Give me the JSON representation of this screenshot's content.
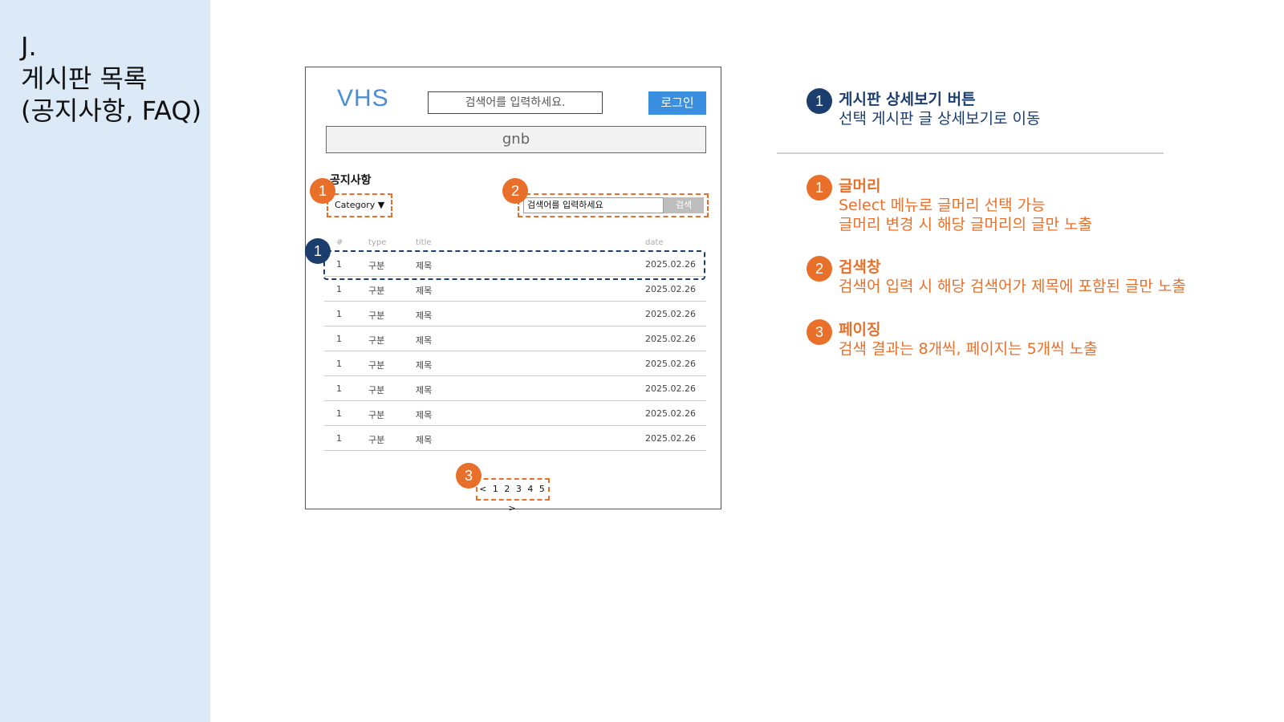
{
  "slide": {
    "title_lines": [
      "J.",
      "게시판 목록",
      "(공지사항, FAQ)"
    ]
  },
  "mockup": {
    "logo": "VHS",
    "top_search_placeholder": "검색어를 입력하세요.",
    "login_label": "로그인",
    "gnb_label": "gnb",
    "board_title": "공지사항",
    "category_label": "Category ▼",
    "search_placeholder": "검색어를 입력하세요",
    "search_button": "검색",
    "columns": [
      "#",
      "type",
      "title",
      "date"
    ],
    "rows": [
      {
        "no": "1",
        "type": "구분",
        "title": "제목",
        "date": "2025.02.26"
      },
      {
        "no": "1",
        "type": "구분",
        "title": "제목",
        "date": "2025.02.26"
      },
      {
        "no": "1",
        "type": "구분",
        "title": "제목",
        "date": "2025.02.26"
      },
      {
        "no": "1",
        "type": "구분",
        "title": "제목",
        "date": "2025.02.26"
      },
      {
        "no": "1",
        "type": "구분",
        "title": "제목",
        "date": "2025.02.26"
      },
      {
        "no": "1",
        "type": "구분",
        "title": "제목",
        "date": "2025.02.26"
      },
      {
        "no": "1",
        "type": "구분",
        "title": "제목",
        "date": "2025.02.26"
      },
      {
        "no": "1",
        "type": "구분",
        "title": "제목",
        "date": "2025.02.26"
      }
    ],
    "pagination": "< 1 2 3 4 5 >"
  },
  "badges": {
    "category": "1",
    "search": "2",
    "row": "1",
    "paging": "3"
  },
  "annotations": {
    "detail": {
      "num": "1",
      "head": "게시판 상세보기 버튼",
      "lines": [
        "선택 게시판 글 상세보기로 이동"
      ]
    },
    "category": {
      "num": "1",
      "head": "글머리",
      "lines": [
        "Select 메뉴로 글머리 선택 가능",
        "글머리 변경 시 해당 글머리의 글만 노출"
      ]
    },
    "search": {
      "num": "2",
      "head": "검색창",
      "lines": [
        "검색어 입력 시 해당 검색어가 제목에 포함된 글만 노출"
      ]
    },
    "paging": {
      "num": "3",
      "head": "페이징",
      "lines": [
        "검색 결과는 8개씩, 페이지는 5개씩 노출"
      ]
    }
  },
  "colors": {
    "sidebar": "#dce9f6",
    "accent_orange": "#e8702a",
    "accent_navy": "#1b3e6e",
    "login_blue": "#3a8fe0"
  }
}
